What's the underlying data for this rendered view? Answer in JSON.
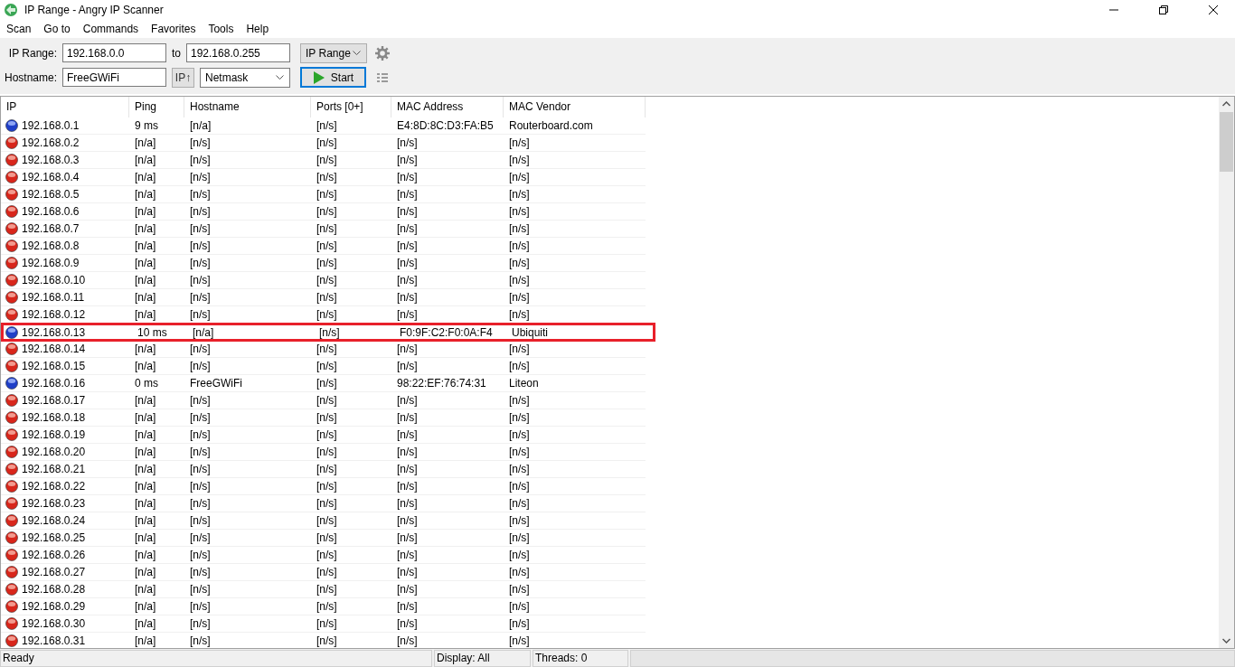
{
  "window": {
    "title": "IP Range - Angry IP Scanner"
  },
  "menu": [
    "Scan",
    "Go to",
    "Commands",
    "Favorites",
    "Tools",
    "Help"
  ],
  "toolbar": {
    "range_label": "IP Range:",
    "from": "192.168.0.0",
    "to_label": "to",
    "to": "192.168.0.255",
    "mode": "IP Range",
    "hostname_label": "Hostname:",
    "hostname": "FreeGWiFi",
    "ip_button": "IP↑",
    "netmask": "Netmask",
    "start": "Start"
  },
  "table": {
    "columns": [
      "IP",
      "Ping",
      "Hostname",
      "Ports [0+]",
      "MAC Address",
      "MAC Vendor"
    ],
    "rows": [
      {
        "cells": [
          "192.168.0.1",
          "9 ms",
          "[n/a]",
          "[n/s]",
          "E4:8D:8C:D3:FA:B5",
          "Routerboard.com"
        ],
        "alive": true,
        "highlighted": false
      },
      {
        "cells": [
          "192.168.0.2",
          "[n/a]",
          "[n/s]",
          "[n/s]",
          "[n/s]",
          "[n/s]"
        ],
        "alive": false,
        "highlighted": false
      },
      {
        "cells": [
          "192.168.0.3",
          "[n/a]",
          "[n/s]",
          "[n/s]",
          "[n/s]",
          "[n/s]"
        ],
        "alive": false,
        "highlighted": false
      },
      {
        "cells": [
          "192.168.0.4",
          "[n/a]",
          "[n/s]",
          "[n/s]",
          "[n/s]",
          "[n/s]"
        ],
        "alive": false,
        "highlighted": false
      },
      {
        "cells": [
          "192.168.0.5",
          "[n/a]",
          "[n/s]",
          "[n/s]",
          "[n/s]",
          "[n/s]"
        ],
        "alive": false,
        "highlighted": false
      },
      {
        "cells": [
          "192.168.0.6",
          "[n/a]",
          "[n/s]",
          "[n/s]",
          "[n/s]",
          "[n/s]"
        ],
        "alive": false,
        "highlighted": false
      },
      {
        "cells": [
          "192.168.0.7",
          "[n/a]",
          "[n/s]",
          "[n/s]",
          "[n/s]",
          "[n/s]"
        ],
        "alive": false,
        "highlighted": false
      },
      {
        "cells": [
          "192.168.0.8",
          "[n/a]",
          "[n/s]",
          "[n/s]",
          "[n/s]",
          "[n/s]"
        ],
        "alive": false,
        "highlighted": false
      },
      {
        "cells": [
          "192.168.0.9",
          "[n/a]",
          "[n/s]",
          "[n/s]",
          "[n/s]",
          "[n/s]"
        ],
        "alive": false,
        "highlighted": false
      },
      {
        "cells": [
          "192.168.0.10",
          "[n/a]",
          "[n/s]",
          "[n/s]",
          "[n/s]",
          "[n/s]"
        ],
        "alive": false,
        "highlighted": false
      },
      {
        "cells": [
          "192.168.0.11",
          "[n/a]",
          "[n/s]",
          "[n/s]",
          "[n/s]",
          "[n/s]"
        ],
        "alive": false,
        "highlighted": false
      },
      {
        "cells": [
          "192.168.0.12",
          "[n/a]",
          "[n/s]",
          "[n/s]",
          "[n/s]",
          "[n/s]"
        ],
        "alive": false,
        "highlighted": false
      },
      {
        "cells": [
          "192.168.0.13",
          "10 ms",
          "[n/a]",
          "[n/s]",
          "F0:9F:C2:F0:0A:F4",
          "Ubiquiti"
        ],
        "alive": true,
        "highlighted": true
      },
      {
        "cells": [
          "192.168.0.14",
          "[n/a]",
          "[n/s]",
          "[n/s]",
          "[n/s]",
          "[n/s]"
        ],
        "alive": false,
        "highlighted": false
      },
      {
        "cells": [
          "192.168.0.15",
          "[n/a]",
          "[n/s]",
          "[n/s]",
          "[n/s]",
          "[n/s]"
        ],
        "alive": false,
        "highlighted": false
      },
      {
        "cells": [
          "192.168.0.16",
          "0 ms",
          "FreeGWiFi",
          "[n/s]",
          "98:22:EF:76:74:31",
          "Liteon"
        ],
        "alive": true,
        "highlighted": false
      },
      {
        "cells": [
          "192.168.0.17",
          "[n/a]",
          "[n/s]",
          "[n/s]",
          "[n/s]",
          "[n/s]"
        ],
        "alive": false,
        "highlighted": false
      },
      {
        "cells": [
          "192.168.0.18",
          "[n/a]",
          "[n/s]",
          "[n/s]",
          "[n/s]",
          "[n/s]"
        ],
        "alive": false,
        "highlighted": false
      },
      {
        "cells": [
          "192.168.0.19",
          "[n/a]",
          "[n/s]",
          "[n/s]",
          "[n/s]",
          "[n/s]"
        ],
        "alive": false,
        "highlighted": false
      },
      {
        "cells": [
          "192.168.0.20",
          "[n/a]",
          "[n/s]",
          "[n/s]",
          "[n/s]",
          "[n/s]"
        ],
        "alive": false,
        "highlighted": false
      },
      {
        "cells": [
          "192.168.0.21",
          "[n/a]",
          "[n/s]",
          "[n/s]",
          "[n/s]",
          "[n/s]"
        ],
        "alive": false,
        "highlighted": false
      },
      {
        "cells": [
          "192.168.0.22",
          "[n/a]",
          "[n/s]",
          "[n/s]",
          "[n/s]",
          "[n/s]"
        ],
        "alive": false,
        "highlighted": false
      },
      {
        "cells": [
          "192.168.0.23",
          "[n/a]",
          "[n/s]",
          "[n/s]",
          "[n/s]",
          "[n/s]"
        ],
        "alive": false,
        "highlighted": false
      },
      {
        "cells": [
          "192.168.0.24",
          "[n/a]",
          "[n/s]",
          "[n/s]",
          "[n/s]",
          "[n/s]"
        ],
        "alive": false,
        "highlighted": false
      },
      {
        "cells": [
          "192.168.0.25",
          "[n/a]",
          "[n/s]",
          "[n/s]",
          "[n/s]",
          "[n/s]"
        ],
        "alive": false,
        "highlighted": false
      },
      {
        "cells": [
          "192.168.0.26",
          "[n/a]",
          "[n/s]",
          "[n/s]",
          "[n/s]",
          "[n/s]"
        ],
        "alive": false,
        "highlighted": false
      },
      {
        "cells": [
          "192.168.0.27",
          "[n/a]",
          "[n/s]",
          "[n/s]",
          "[n/s]",
          "[n/s]"
        ],
        "alive": false,
        "highlighted": false
      },
      {
        "cells": [
          "192.168.0.28",
          "[n/a]",
          "[n/s]",
          "[n/s]",
          "[n/s]",
          "[n/s]"
        ],
        "alive": false,
        "highlighted": false
      },
      {
        "cells": [
          "192.168.0.29",
          "[n/a]",
          "[n/s]",
          "[n/s]",
          "[n/s]",
          "[n/s]"
        ],
        "alive": false,
        "highlighted": false
      },
      {
        "cells": [
          "192.168.0.30",
          "[n/a]",
          "[n/s]",
          "[n/s]",
          "[n/s]",
          "[n/s]"
        ],
        "alive": false,
        "highlighted": false
      },
      {
        "cells": [
          "192.168.0.31",
          "[n/a]",
          "[n/s]",
          "[n/s]",
          "[n/s]",
          "[n/s]"
        ],
        "alive": false,
        "highlighted": false
      }
    ]
  },
  "status_bar": [
    "Ready",
    "Display: All",
    "Threads: 0"
  ]
}
